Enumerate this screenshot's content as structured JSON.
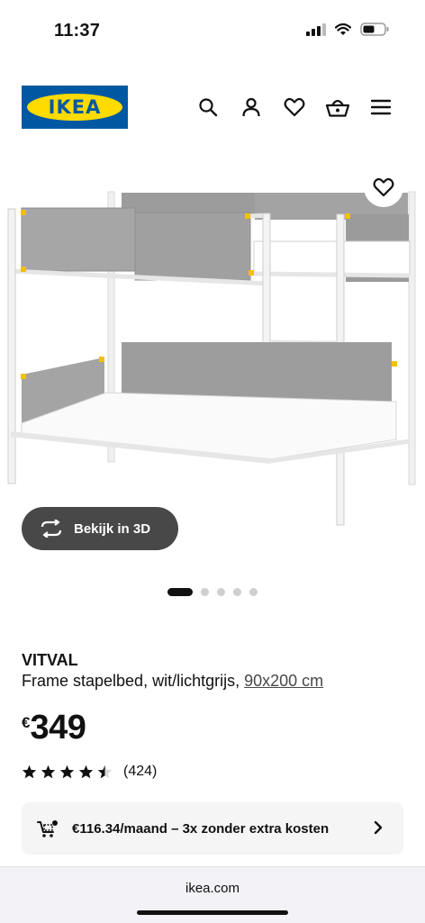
{
  "status_bar": {
    "time": "11:37"
  },
  "header": {
    "logo_text": "IKEA"
  },
  "gallery": {
    "view_3d_label": "Bekijk in 3D",
    "dot_count": 5,
    "active_index": 0
  },
  "product": {
    "name": "VITVAL",
    "description": "Frame stapelbed, wit/lichtgrijs,",
    "size": "90x200 cm",
    "currency": "€",
    "price": "349",
    "rating": 4.5,
    "review_count": "(424)"
  },
  "financing": {
    "text": "€116.34/maand – 3x zonder extra kosten"
  },
  "browser": {
    "url": "ikea.com"
  },
  "colors": {
    "ikea_blue": "#0058a3",
    "ikea_yellow": "#ffdb00",
    "button_dark": "#484848",
    "finance_bg": "#f5f5f5"
  }
}
